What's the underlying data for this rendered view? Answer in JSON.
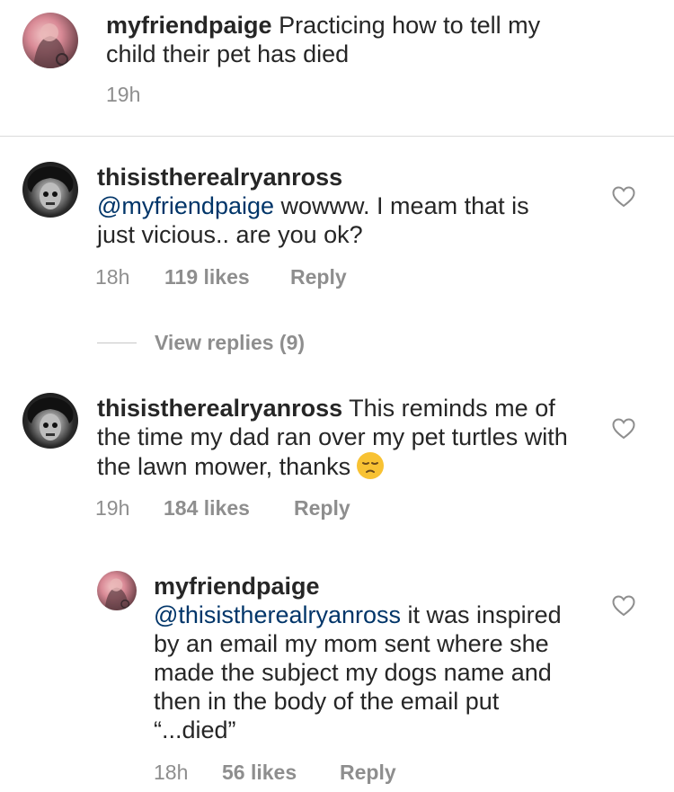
{
  "caption": {
    "username": "myfriendpaige",
    "text": "Practicing how to tell my child their pet has died",
    "time": "19h"
  },
  "comments": [
    {
      "username": "thisistherealryanross",
      "mention": "@myfriendpaige",
      "text": "wowww. I meam that is just vicious.. are you ok?",
      "time": "18h",
      "likes": "119 likes",
      "reply_label": "Reply",
      "view_replies": "View replies (9)"
    },
    {
      "username": "thisistherealryanross",
      "text": "This reminds me of the time my dad ran over my pet turtles with the lawn mower, thanks",
      "emoji": "pensive-face-emoji",
      "time": "19h",
      "likes": "184 likes",
      "reply_label": "Reply"
    },
    {
      "username": "myfriendpaige",
      "mention": "@thisistherealryanross",
      "text": "it was inspired by an email my mom sent where she made the subject my dogs name and then in the body of the email put “...died”",
      "time": "18h",
      "likes": "56 likes",
      "reply_label": "Reply"
    }
  ],
  "icons": {
    "like": "heart-outline-icon"
  },
  "colors": {
    "text": "#262626",
    "mention": "#003569",
    "meta": "#8e8e8e",
    "divider": "#dbdbdb"
  }
}
